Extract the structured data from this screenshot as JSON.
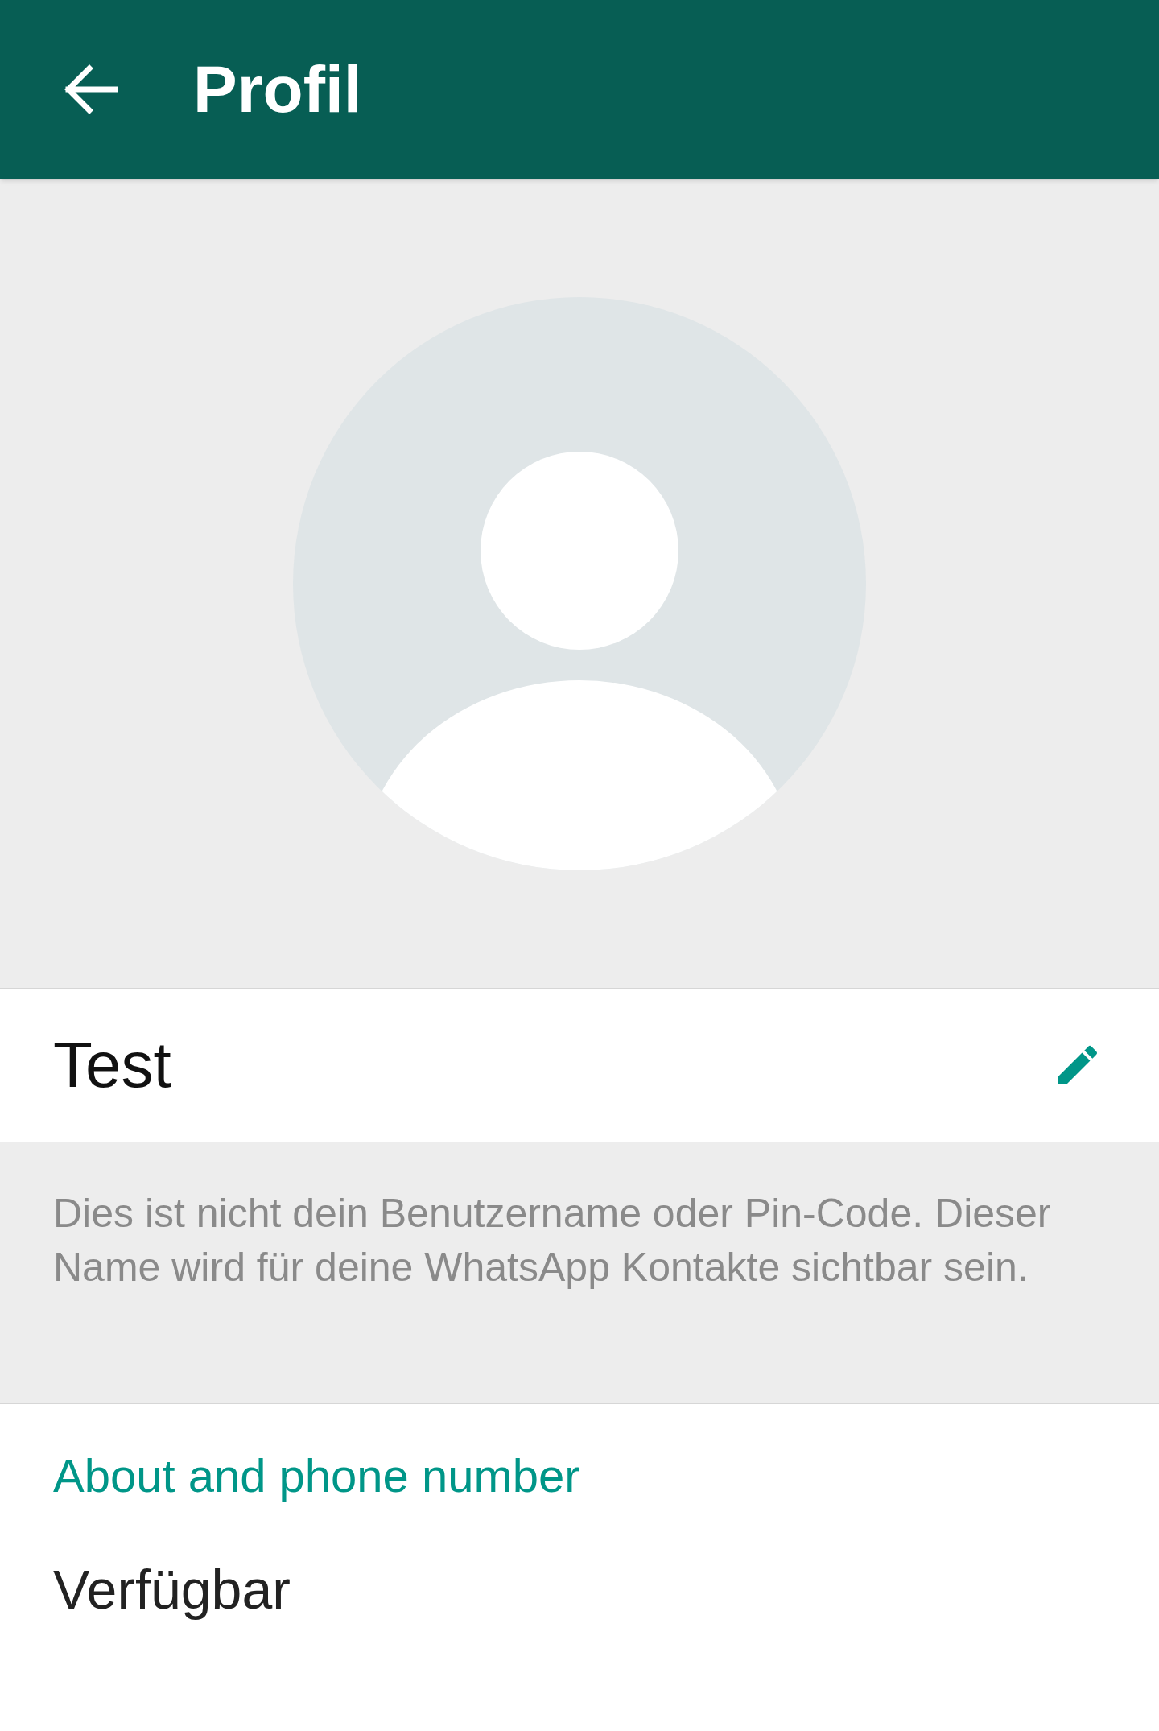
{
  "header": {
    "title": "Profil"
  },
  "name_row": {
    "name": "Test"
  },
  "hint": "Dies ist nicht dein Benutzername oder Pin-Code. Dieser Name wird für deine WhatsApp Kontakte sichtbar sein.",
  "about_section": {
    "title": "About and phone number",
    "status": "Verfügbar"
  }
}
